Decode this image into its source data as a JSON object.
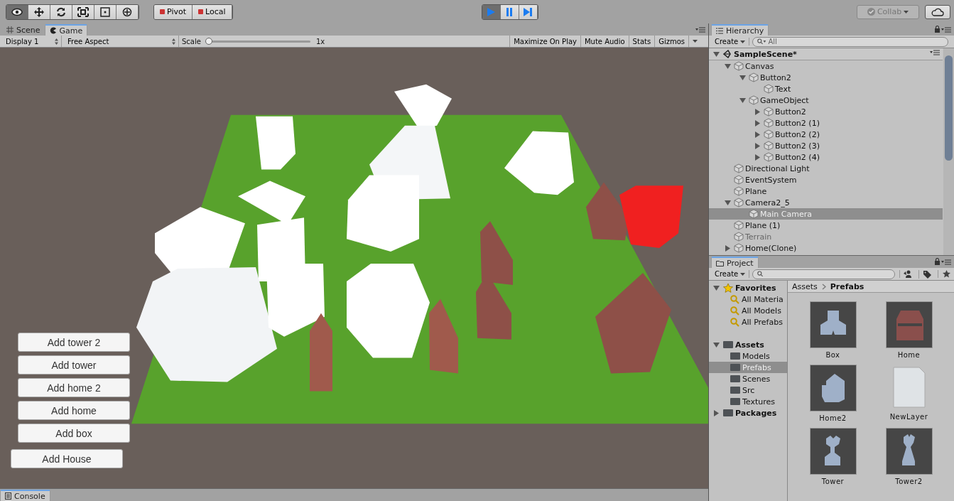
{
  "toolbar": {
    "tools": [
      {
        "kind": "view",
        "selected": true
      },
      {
        "kind": "move",
        "selected": false
      },
      {
        "kind": "rotate",
        "selected": false
      },
      {
        "kind": "scale",
        "selected": false
      },
      {
        "kind": "rect",
        "selected": false
      },
      {
        "kind": "transform",
        "selected": false
      }
    ],
    "pivot": "Pivot",
    "local": "Local",
    "playback": [
      {
        "kind": "play",
        "selected": true
      },
      {
        "kind": "pause",
        "selected": false
      },
      {
        "kind": "step",
        "selected": false
      }
    ],
    "collab": "Collab"
  },
  "game_panel": {
    "tabs": [
      {
        "kind": "scene",
        "label": "Scene",
        "selected": false
      },
      {
        "kind": "game",
        "label": "Game",
        "selected": true
      }
    ],
    "display": "Display 1",
    "aspect": "Free Aspect",
    "scale_label": "Scale",
    "scale": {
      "level": 0,
      "reading": "1x"
    },
    "options": [
      "Maximize On Play",
      "Mute Audio",
      "Stats",
      "Gizmos"
    ],
    "buttons": [
      "Add tower 2",
      "Add tower",
      "Add home 2",
      "Add home",
      "Add box",
      "Add House"
    ]
  },
  "console_tab": "Console",
  "hierarchy": {
    "title": "Hierarchy",
    "create": "Create",
    "search": {
      "placeholder": "All"
    },
    "scene": "SampleScene*",
    "tree": [
      {
        "label": "Canvas",
        "expanded": true,
        "selected": false,
        "disabled": false,
        "children": [
          {
            "label": "Button2",
            "expanded": true,
            "selected": false,
            "disabled": false,
            "children": [
              {
                "label": "Text",
                "selected": false,
                "disabled": false
              }
            ]
          },
          {
            "label": "GameObject",
            "expanded": true,
            "selected": false,
            "disabled": false,
            "children": [
              {
                "label": "Button2",
                "expanded": false,
                "selected": false,
                "disabled": false
              },
              {
                "label": "Button2 (1)",
                "expanded": false,
                "selected": false,
                "disabled": false
              },
              {
                "label": "Button2 (2)",
                "expanded": false,
                "selected": false,
                "disabled": false
              },
              {
                "label": "Button2 (3)",
                "expanded": false,
                "selected": false,
                "disabled": false
              },
              {
                "label": "Button2 (4)",
                "expanded": false,
                "selected": false,
                "disabled": false
              }
            ]
          }
        ]
      },
      {
        "label": "Directional Light",
        "selected": false,
        "disabled": false
      },
      {
        "label": "EventSystem",
        "selected": false,
        "disabled": false
      },
      {
        "label": "Plane",
        "selected": false,
        "disabled": false
      },
      {
        "label": "Camera2_5",
        "expanded": true,
        "selected": false,
        "disabled": false,
        "children": [
          {
            "label": "Main Camera",
            "selected": true,
            "disabled": false
          }
        ]
      },
      {
        "label": "Plane (1)",
        "selected": false,
        "disabled": false
      },
      {
        "label": "Terrain",
        "selected": false,
        "disabled": true
      },
      {
        "label": "Home(Clone)",
        "expanded": false,
        "selected": false,
        "disabled": false
      }
    ]
  },
  "project": {
    "title": "Project",
    "create": "Create",
    "favorites": {
      "label": "Favorites",
      "expanded": true,
      "items": [
        "All Materia",
        "All Models",
        "All Prefabs"
      ]
    },
    "assets": {
      "label": "Assets",
      "expanded": true,
      "folders": [
        {
          "label": "Models",
          "selected": false
        },
        {
          "label": "Prefabs",
          "selected": true
        },
        {
          "label": "Scenes",
          "selected": false
        },
        {
          "label": "Src",
          "selected": false
        },
        {
          "label": "Textures",
          "selected": false
        }
      ]
    },
    "packages": {
      "label": "Packages",
      "expanded": false
    },
    "breadcrumb": [
      "Assets",
      "Prefabs"
    ],
    "items": [
      {
        "name": "Box",
        "kind": "box"
      },
      {
        "name": "Home",
        "kind": "house"
      },
      {
        "name": "Home2",
        "kind": "home2"
      },
      {
        "name": "NewLayer",
        "kind": "file"
      },
      {
        "name": "Tower",
        "kind": "tower"
      },
      {
        "name": "Tower2",
        "kind": "tower2"
      }
    ]
  }
}
